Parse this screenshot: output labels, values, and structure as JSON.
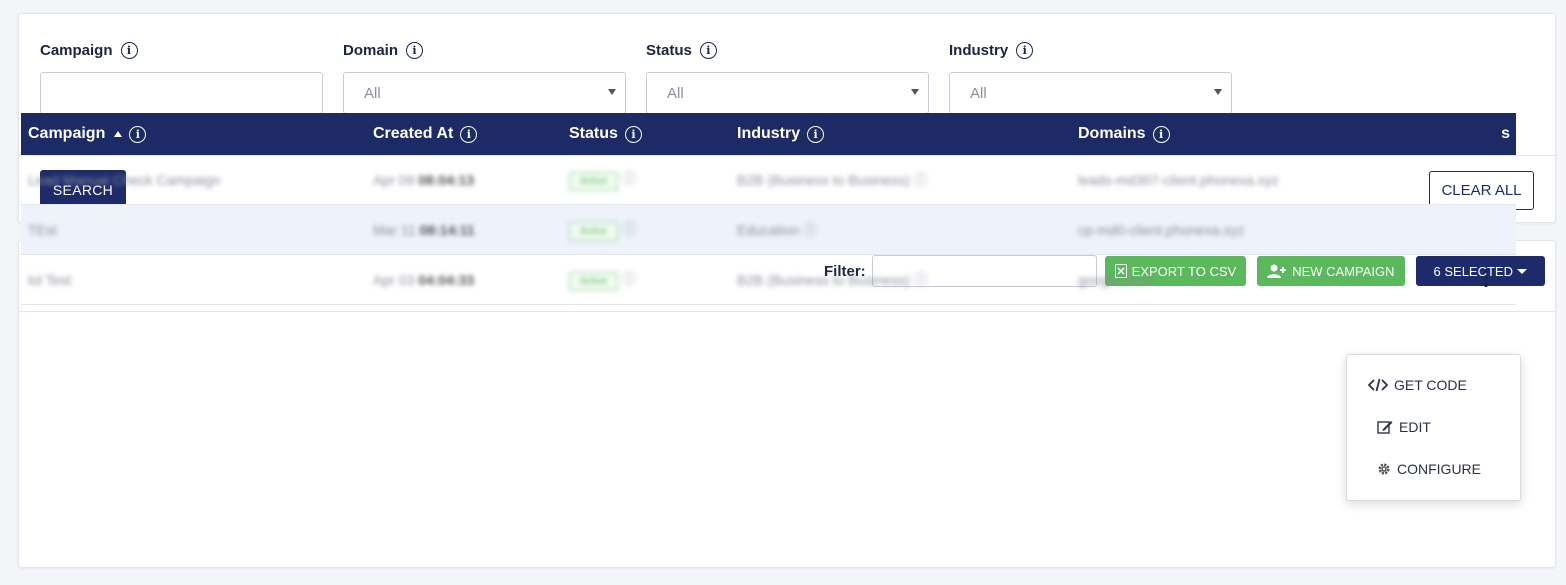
{
  "filters": {
    "campaign": {
      "label": "Campaign",
      "value": ""
    },
    "domain": {
      "label": "Domain",
      "value": "All"
    },
    "status": {
      "label": "Status",
      "value": "All"
    },
    "industry": {
      "label": "Industry",
      "value": "All"
    },
    "search_label": "SEARCH",
    "clear_label": "CLEAR ALL"
  },
  "toolbar": {
    "filter_label": "Filter:",
    "filter_value": "",
    "export_label": "EXPORT TO CSV",
    "new_campaign_label": "NEW CAMPAIGN",
    "selected_label": "6 SELECTED"
  },
  "table": {
    "headers": [
      "Campaign",
      "Created At",
      "Status",
      "Industry",
      "Domains",
      "Actions"
    ],
    "header_tail": "s",
    "rows": [
      {
        "campaign": "Lead Manual Check Campaign",
        "date": "Apr 09",
        "time": "08:04:13",
        "status": "Active",
        "industry": "B2B (Business to Business)",
        "domains": "leads-md307-client.phonexa.xyz"
      },
      {
        "campaign": "TEst",
        "date": "Mar 11",
        "time": "08:14:11",
        "status": "Active",
        "industry": "Education",
        "domains": "cp-md0-client.phonexa.xyz"
      },
      {
        "campaign": "lol Test",
        "date": "Apr 03",
        "time": "04:04:33",
        "status": "Active",
        "industry": "B2B (Business to Business)",
        "domains": "google.com"
      }
    ]
  },
  "menu": {
    "items": [
      "GET CODE",
      "EDIT",
      "CONFIGURE"
    ]
  },
  "colors": {
    "navy": "#1e2b6b",
    "green": "#5cb85c",
    "row_alt": "#eef2fb"
  },
  "icons": [
    "info-icon",
    "caret-down-icon",
    "excel-icon",
    "user-plus-icon",
    "code-icon",
    "edit-icon",
    "gear-icon",
    "kebab-icon",
    "sort-asc-icon"
  ]
}
